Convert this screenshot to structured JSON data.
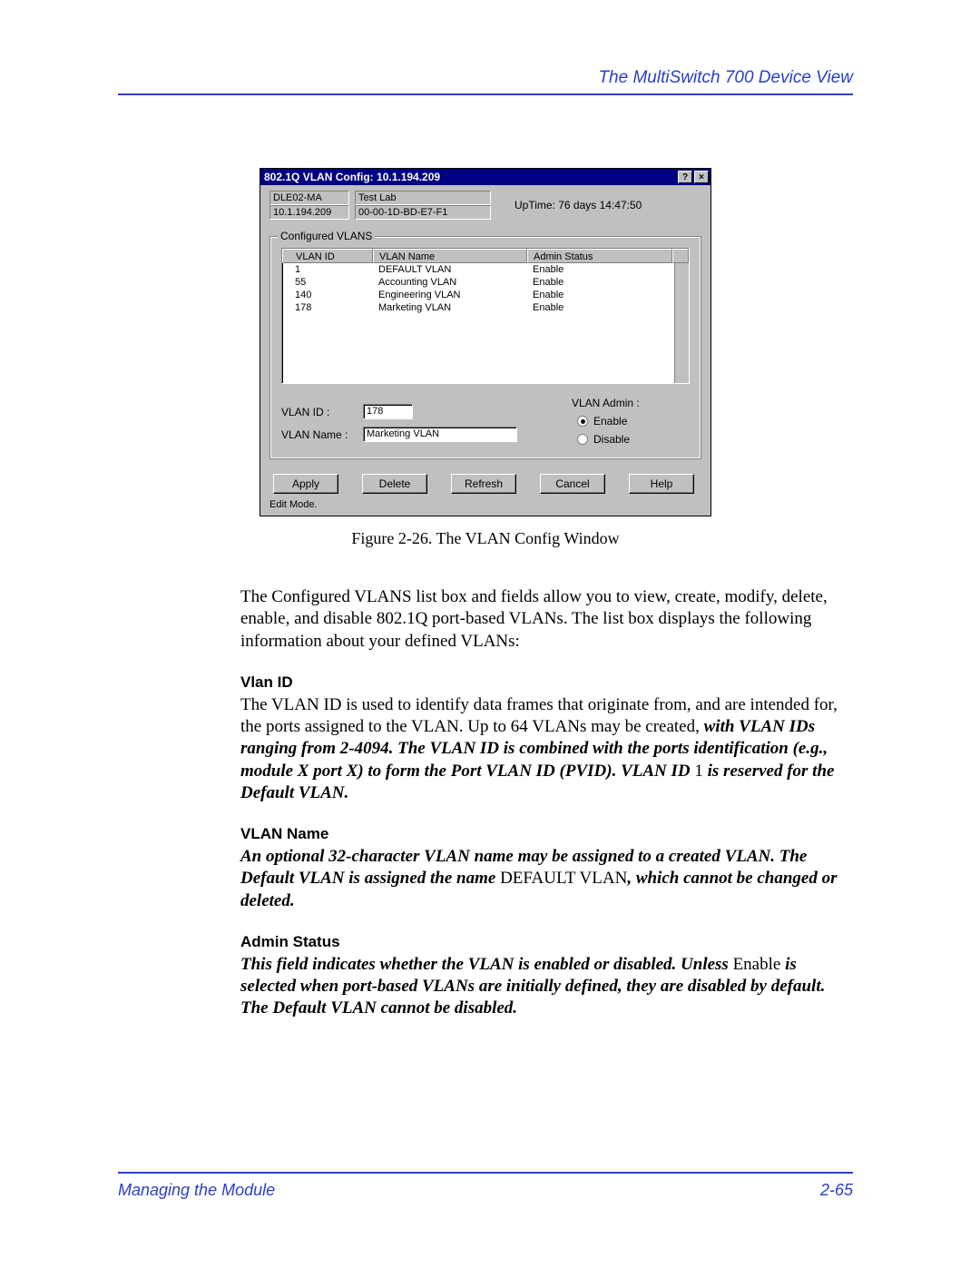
{
  "header": {
    "right": "The MultiSwitch 700 Device View"
  },
  "window": {
    "title": "802.1Q VLAN Config: 10.1.194.209",
    "device_name": "DLE02-MA",
    "device_ip": "10.1.194.209",
    "location": "Test Lab",
    "mac": "00-00-1D-BD-E7-F1",
    "uptime_label": "UpTime: 76 days 14:47:50",
    "group_legend": "Configured VLANS",
    "columns": {
      "id": "VLAN ID",
      "name": "VLAN Name",
      "status": "Admin Status"
    },
    "rows": [
      {
        "id": "1",
        "name": "DEFAULT VLAN",
        "status": "Enable"
      },
      {
        "id": "55",
        "name": "Accounting VLAN",
        "status": "Enable"
      },
      {
        "id": "140",
        "name": "Engineering VLAN",
        "status": "Enable"
      },
      {
        "id": "178",
        "name": "Marketing VLAN",
        "status": "Enable"
      }
    ],
    "field_id_label": "VLAN ID :",
    "field_id_value": "178",
    "field_name_label": "VLAN Name :",
    "field_name_value": "Marketing VLAN",
    "admin_label": "VLAN Admin :",
    "radio_enable": "Enable",
    "radio_disable": "Disable",
    "buttons": {
      "apply": "Apply",
      "delete": "Delete",
      "refresh": "Refresh",
      "cancel": "Cancel",
      "help": "Help"
    },
    "status_text": "Edit Mode.",
    "help_glyph": "?",
    "close_glyph": "×"
  },
  "caption": "Figure 2-26.  The VLAN Config Window",
  "para_intro": "The Configured VLANS  list box and fields allow you to view, create, modify, delete, enable, and disable 802.1Q port-based VLANs. The list box displays the following information about your defined VLANs:",
  "sec1": {
    "h": "Vlan ID",
    "p1": "The VLAN ID is used to identify data frames that originate from, and are intended for, the ports assigned to the VLAN. Up to 64 VLANs may be created, ",
    "p2": "with VLAN IDs ranging from 2-4094. The VLAN ID is combined with the ports identification (e.g., module X port X) to form the Port VLAN ID (PVID). VLAN ID ",
    "p3_prefix": "1",
    "p3_rest": " is reserved for the Default VLAN."
  },
  "sec2": {
    "h": "VLAN Name",
    "p1": "An optional 32-character VLAN name may be assigned to a created VLAN. The Default VLAN is assigned the name ",
    "p_plain": "DEFAULT VLAN",
    "p2": ", which cannot be changed or deleted."
  },
  "sec3": {
    "h": "Admin Status",
    "p1": "This field indicates whether the VLAN is enabled or disabled. Unless ",
    "p_plain": "Enable",
    "p2": " is selected when port-based VLANs are initially defined, they are disabled by default. The Default VLAN cannot be disabled."
  },
  "footer": {
    "left": "Managing the Module",
    "right": "2-65"
  }
}
